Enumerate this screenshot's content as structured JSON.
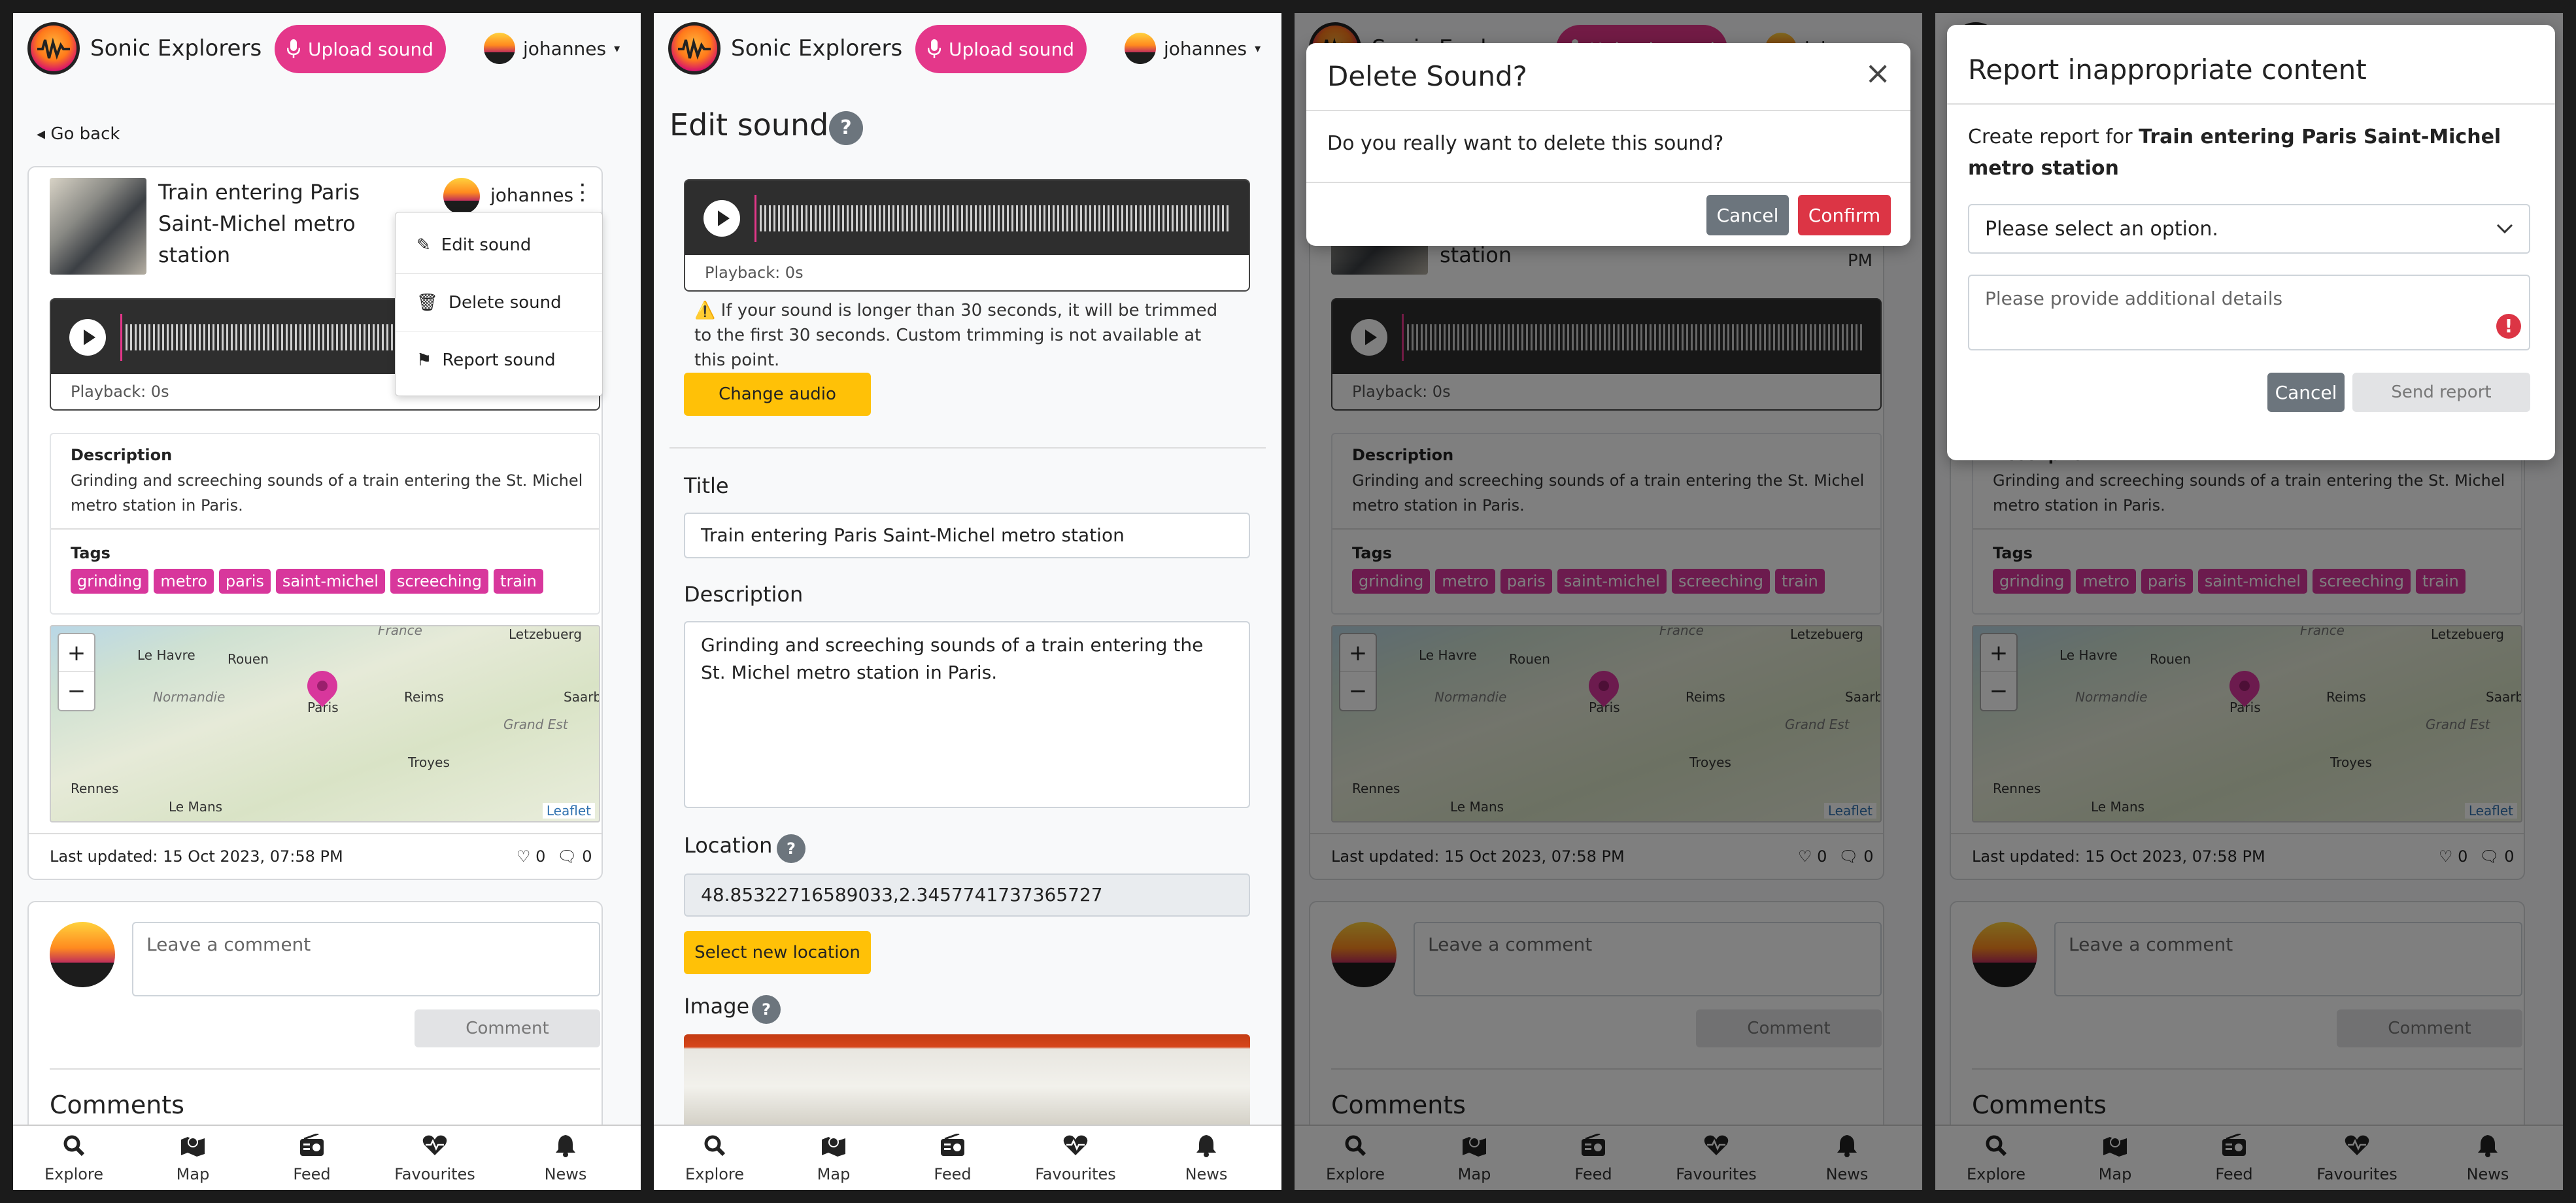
{
  "app": {
    "brand": "Sonic Explorers",
    "upload_label": "Upload sound",
    "username": "johannes"
  },
  "colors": {
    "accent": "#e4378a",
    "warning": "#ffc107",
    "danger": "#dc3545",
    "secondary": "#6c757d"
  },
  "nav": [
    {
      "icon": "search-icon",
      "label": "Explore"
    },
    {
      "icon": "map-icon",
      "label": "Map"
    },
    {
      "icon": "radio-icon",
      "label": "Feed"
    },
    {
      "icon": "heart-pulse-icon",
      "label": "Favourites"
    },
    {
      "icon": "bell-icon",
      "label": "News"
    }
  ],
  "sound": {
    "go_back": "Go back",
    "title": "Train entering Paris Saint-Michel metro station",
    "title_lines": [
      "Train entering Paris",
      "Saint-Michel metro",
      "station"
    ],
    "owner": "johannes",
    "playback": "Playback: 0s",
    "description_label": "Description",
    "description": "Grinding and screeching sounds of a train entering the St. Michel metro station in Paris.",
    "tags_label": "Tags",
    "tags": [
      "grinding",
      "metro",
      "paris",
      "saint-michel",
      "screeching",
      "train"
    ],
    "last_updated": "Last updated: 15 Oct 2023, 07:58 PM",
    "likes": "0",
    "comments_count": "0",
    "time_fragment": "PM",
    "comment_placeholder": "Leave a comment",
    "comment_button": "Comment",
    "comments_heading": "Comments"
  },
  "map": {
    "zoom_in": "+",
    "zoom_out": "−",
    "attribution": "Leaflet",
    "cities": [
      "Le Havre",
      "Rouen",
      "Paris",
      "Reims",
      "Troyes",
      "Rennes",
      "Le Mans",
      "Letzebuerg",
      "Saarb"
    ],
    "regions": [
      "Normandie",
      "Grand Est",
      "France"
    ]
  },
  "dropdown": {
    "items": [
      {
        "icon": "edit-icon",
        "label": "Edit sound"
      },
      {
        "icon": "trash-icon",
        "label": "Delete sound"
      },
      {
        "icon": "flag-icon",
        "label": "Report sound"
      }
    ]
  },
  "edit": {
    "heading": "Edit sound",
    "help": "?",
    "warning_icon": "⚠️",
    "trim_warning": "If your sound is longer than 30 seconds, it will be trimmed to the first 30 seconds. Custom trimming is not available at this point.",
    "change_audio": "Change audio",
    "title_label": "Title",
    "title_value": "Train entering Paris Saint-Michel metro station",
    "description_label": "Description",
    "description_value": "Grinding and screeching sounds of a train entering the St. Michel metro station in Paris.",
    "location_label": "Location",
    "location_value": "48.85322716589033,2.3457741737365727",
    "select_location": "Select new location",
    "image_label": "Image"
  },
  "delete_modal": {
    "title": "Delete Sound?",
    "close": "×",
    "body": "Do you really want to delete this sound?",
    "cancel": "Cancel",
    "confirm": "Confirm"
  },
  "report_modal": {
    "title": "Report inappropriate content",
    "create_prefix": "Create report for ",
    "sound_title": "Train entering Paris Saint-Michel metro station",
    "select_placeholder": "Please select an option.",
    "details_placeholder": "Please provide additional details",
    "invalid_icon": "!",
    "cancel": "Cancel",
    "send": "Send report"
  }
}
